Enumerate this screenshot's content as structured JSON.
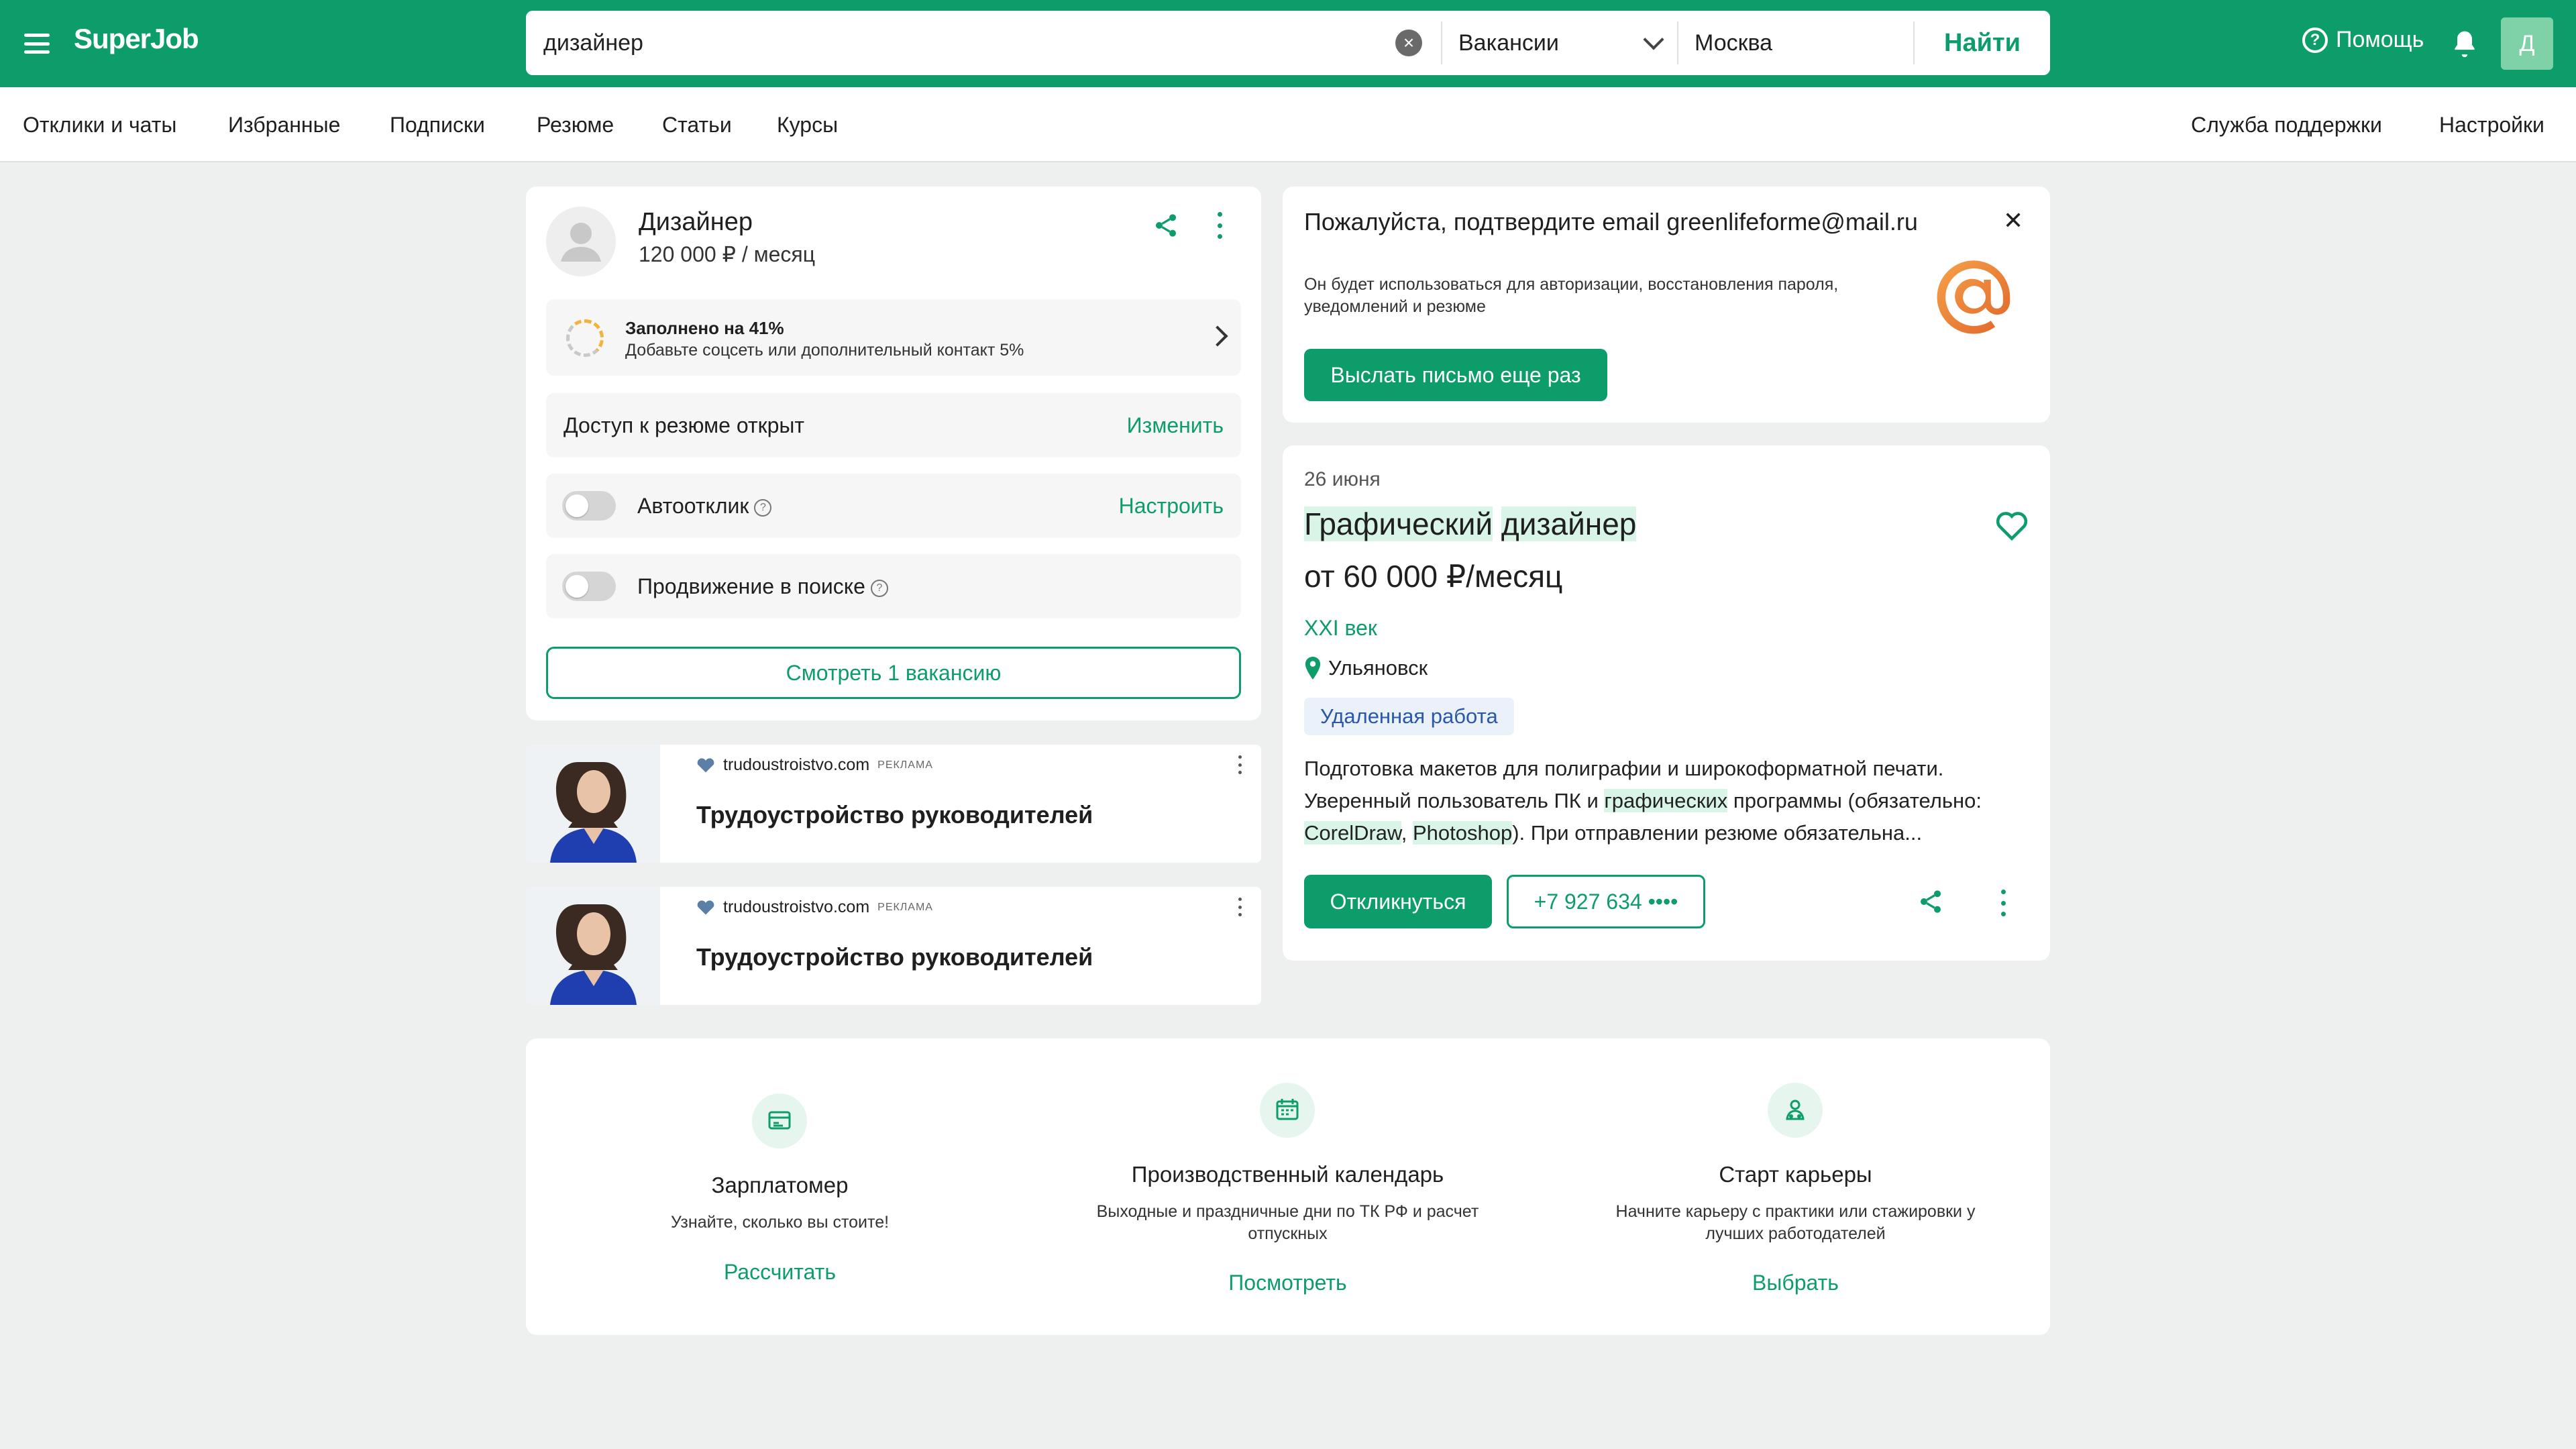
{
  "header": {
    "logo": "SuperJob",
    "search_value": "дизайнер",
    "search_type": "Вакансии",
    "city": "Москва",
    "find_label": "Найти",
    "help_label": "Помощь",
    "avatar_letter": "Д"
  },
  "nav": {
    "items": [
      "Отклики и чаты",
      "Избранные",
      "Подписки",
      "Резюме",
      "Статьи",
      "Курсы"
    ],
    "support": "Служба поддержки",
    "settings": "Настройки"
  },
  "resume": {
    "title": "Дизайнер",
    "salary": "120 000 ₽ / месяц",
    "fill_title": "Заполнено на 41%",
    "fill_sub": "Добавьте соцсеть или дополнительный контакт 5%",
    "fill_percent": 41,
    "access_label": "Доступ к резюме открыт",
    "access_action": "Изменить",
    "autoreply_label": "Автоотклик",
    "autoreply_action": "Настроить",
    "promo_label": "Продвижение в поиске",
    "view_button": "Смотреть 1 вакансию"
  },
  "ads": [
    {
      "domain": "trudoustroistvo.com",
      "tag": "РЕКЛАМА",
      "title": "Трудоустройство руководителей"
    },
    {
      "domain": "trudoustroistvo.com",
      "tag": "РЕКЛАМА",
      "title": "Трудоустройство руководителей"
    }
  ],
  "email": {
    "title": "Пожалуйста, подтвердите email greenlifeforme@mail.ru",
    "text": "Он будет использоваться для авторизации, восстановления пароля, уведомлений и резюме",
    "button": "Выслать письмо еще раз"
  },
  "vacancy": {
    "date": "26 июня",
    "title_part1": "Графический",
    "title_part2": "дизайнер",
    "salary": "от 60 000 ₽/месяц",
    "company": "XXI век",
    "city": "Ульяновск",
    "badge": "Удаленная работа",
    "desc_1": "Подготовка макетов для полиграфии и широкоформатной печати. Уверенный пользователь ПК и ",
    "desc_hl1": "графических",
    "desc_2": " программы (обязательно: ",
    "desc_hl2": "CorelDraw",
    "desc_3": ", ",
    "desc_hl3": "Photoshop",
    "desc_4": "). При отправлении резюме обязательна...",
    "respond_button": "Откликнуться",
    "phone_button": "+7 927 634 ••••"
  },
  "services": [
    {
      "title": "Зарплатомер",
      "desc": "Узнайте, сколько вы стоите!",
      "link": "Рассчитать"
    },
    {
      "title": "Производственный календарь",
      "desc": "Выходные и праздничные дни по ТК РФ и расчет отпускных",
      "link": "Посмотреть"
    },
    {
      "title": "Старт карьеры",
      "desc": "Начните карьеру с практики или стажировки у лучших работодателей",
      "link": "Выбрать"
    }
  ],
  "colors": {
    "brand": "#0d9d6a",
    "badge_bg": "#eaf1fb",
    "highlight": "#d9f5e8"
  }
}
